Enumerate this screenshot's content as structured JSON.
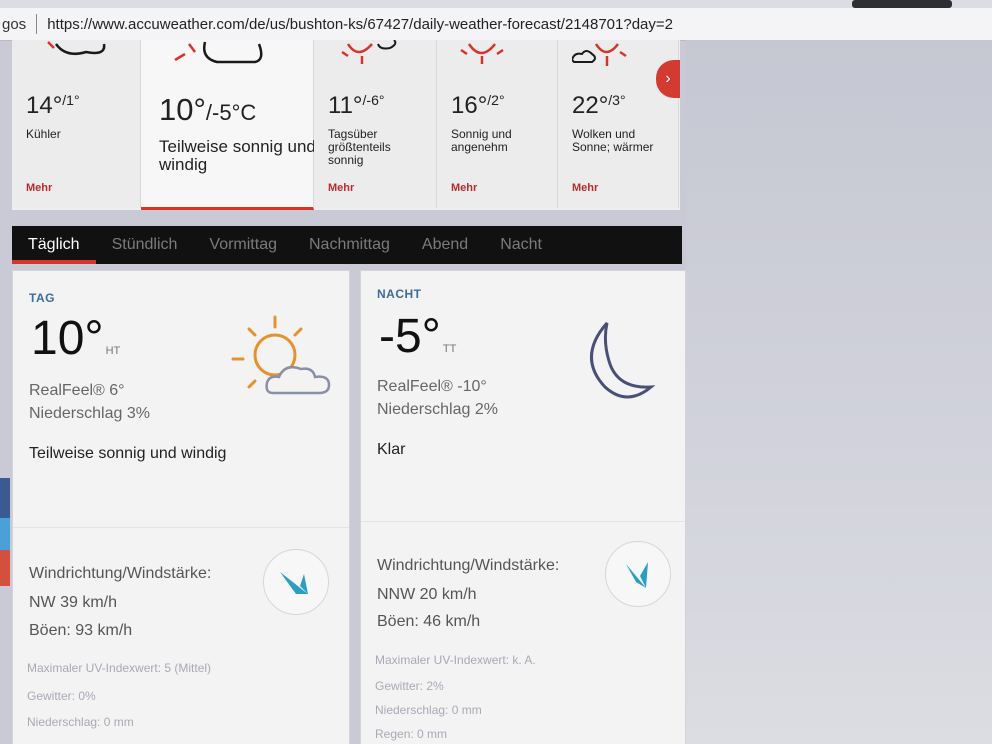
{
  "browser": {
    "tab_fragment": "gos",
    "url": "https://www.accuweather.com/de/us/bushton-ks/67427/daily-weather-forecast/2148701?day=2"
  },
  "days": [
    {
      "hi": "14°",
      "lo": "/1°",
      "desc": "Kühler",
      "more": "Mehr"
    },
    {
      "hi": "10°",
      "lo": "/-5°C",
      "desc": "Teilweise sonnig und windig",
      "more": ""
    },
    {
      "hi": "11°",
      "lo": "/-6°",
      "desc": "Tagsüber größtenteils sonnig",
      "more": "Mehr"
    },
    {
      "hi": "16°",
      "lo": "/2°",
      "desc": "Sonnig und angenehm",
      "more": "Mehr"
    },
    {
      "hi": "22°",
      "lo": "/3°",
      "desc": "Wolken und Sonne; wärmer",
      "more": "Mehr"
    }
  ],
  "tabs": [
    "Täglich",
    "Stündlich",
    "Vormittag",
    "Nachmittag",
    "Abend",
    "Nacht"
  ],
  "day_panel": {
    "label": "TAG",
    "temp": "10°",
    "temp_unit": "HT",
    "realfeel": "RealFeel® 6°",
    "precip": "Niederschlag 3%",
    "phrase": "Teilweise sonnig und windig",
    "wind_label": "Windrichtung/Windstärke:",
    "wind": "NW 39 km/h",
    "gusts": "Böen: 93 km/h",
    "extra": [
      "Maximaler UV-Indexwert: 5 (Mittel)",
      "Gewitter: 0%",
      "Niederschlag: 0 mm"
    ]
  },
  "night_panel": {
    "label": "NACHT",
    "temp": "-5°",
    "temp_unit": "TT",
    "realfeel": "RealFeel® -10°",
    "precip": "Niederschlag 2%",
    "phrase": "Klar",
    "wind_label": "Windrichtung/Windstärke:",
    "wind": "NNW 20 km/h",
    "gusts": "Böen: 46 km/h",
    "extra": [
      "Maximaler UV-Indexwert: k. A.",
      "Gewitter: 2%",
      "Niederschlag: 0 mm",
      "Regen: 0 mm"
    ]
  },
  "colors": {
    "accent_red": "#d9342b",
    "label_blue": "#3d6c98",
    "sun_orange": "#e8902a",
    "moon_navy": "#4a4f78",
    "wind_arrow": "#2a9fc6"
  }
}
